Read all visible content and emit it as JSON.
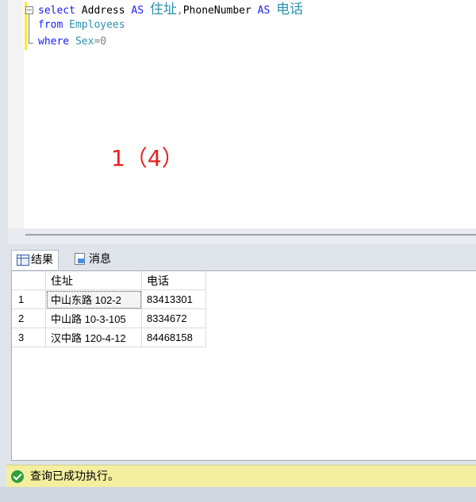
{
  "editor": {
    "line1": {
      "kw1": "select",
      "col1": "Address",
      "kw2": "AS",
      "alias1": "住址",
      "comma": ",",
      "col2": "PhoneNumber",
      "kw3": "AS",
      "alias2": "电话"
    },
    "line2": {
      "kw": "from",
      "table": "Employees"
    },
    "line3": {
      "kw": "where",
      "column": "Sex",
      "op": "=0"
    }
  },
  "annotation": "1（4）",
  "tabs": {
    "results": "结果",
    "messages": "消息"
  },
  "grid": {
    "headers": [
      "",
      "住址",
      "电话"
    ],
    "rows": [
      [
        "1",
        "中山东路 102-2",
        "83413301"
      ],
      [
        "2",
        "中山路 10-3-105",
        "8334672"
      ],
      [
        "3",
        "汉中路 120-4-12",
        "84468158"
      ]
    ]
  },
  "status": {
    "text": "查询已成功执行。"
  },
  "colors": {
    "keyword": "#1a1aff",
    "identifier": "#2b91af",
    "annotation": "#e8201f",
    "status_bg": "#f4ef9f"
  }
}
